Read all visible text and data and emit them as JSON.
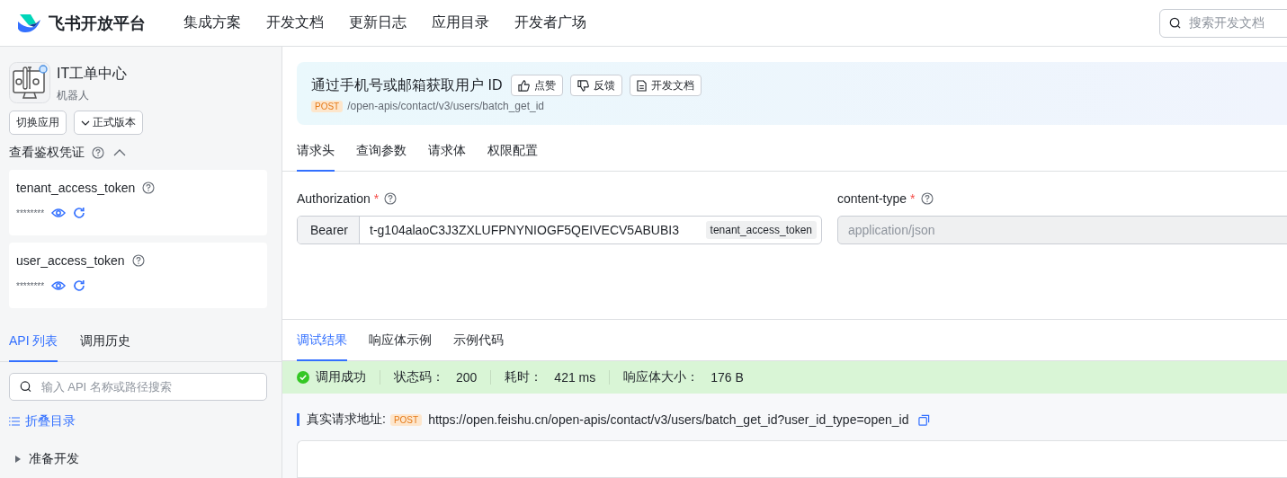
{
  "header": {
    "brand": "飞书开放平台",
    "nav": [
      "集成方案",
      "开发文档",
      "更新日志",
      "应用目录",
      "开发者广场"
    ],
    "search": {
      "placeholder": "搜索开发文档"
    }
  },
  "sidebar": {
    "app": {
      "name": "IT工单中心",
      "type": "机器人"
    },
    "switch_button": "切换应用",
    "version_button": "正式版本",
    "credentials": {
      "title": "查看鉴权凭证",
      "expanded": true,
      "tokens": [
        {
          "name": "tenant_access_token",
          "masked": "********"
        },
        {
          "name": "user_access_token",
          "masked": "********"
        }
      ]
    },
    "tabs": [
      {
        "label": "API 列表",
        "selected": true
      },
      {
        "label": "调用历史",
        "selected": false
      }
    ],
    "search": {
      "placeholder": "输入 API 名称或路径搜索"
    },
    "collapse": "折叠目录",
    "tree": [
      {
        "label": "准备开发",
        "expanded": false
      }
    ]
  },
  "api": {
    "title": "通过手机号或邮箱获取用户 ID",
    "actions": [
      {
        "kind": "like",
        "label": "点赞"
      },
      {
        "kind": "dislike",
        "label": "反馈"
      },
      {
        "kind": "doc",
        "label": "开发文档"
      }
    ],
    "method": "POST",
    "path": "/open-apis/contact/v3/users/batch_get_id"
  },
  "request_tabs": [
    {
      "label": "请求头",
      "selected": true
    },
    {
      "label": "查询参数",
      "selected": false
    },
    {
      "label": "请求体",
      "selected": false
    },
    {
      "label": "权限配置",
      "selected": false
    }
  ],
  "headers": [
    {
      "label": "Authorization",
      "required_mark": "*",
      "prefix": "Bearer",
      "value": "t-g104alaoC3J3ZXLUFPNYNIOGF5QEIVECV5ABUBI3",
      "tag": "tenant_access_token",
      "disabled": false
    },
    {
      "label": "content-type",
      "required_mark": "*",
      "placeholder": "application/json",
      "disabled": true
    }
  ],
  "result_tabs": [
    {
      "label": "调试结果",
      "selected": true
    },
    {
      "label": "响应体示例",
      "selected": false
    },
    {
      "label": "示例代码",
      "selected": false
    }
  ],
  "result": {
    "success": true,
    "status": "调用成功",
    "fields": [
      {
        "label": "状态码：",
        "value": "200"
      },
      {
        "label": "耗时：",
        "value": "421 ms"
      },
      {
        "label": "响应体大小：",
        "value": "176 B"
      }
    ]
  },
  "request_url": {
    "label": "真实请求地址:",
    "method": "POST",
    "url": "https://open.feishu.cn/open-apis/contact/v3/users/batch_get_id?user_id_type=open_id"
  }
}
